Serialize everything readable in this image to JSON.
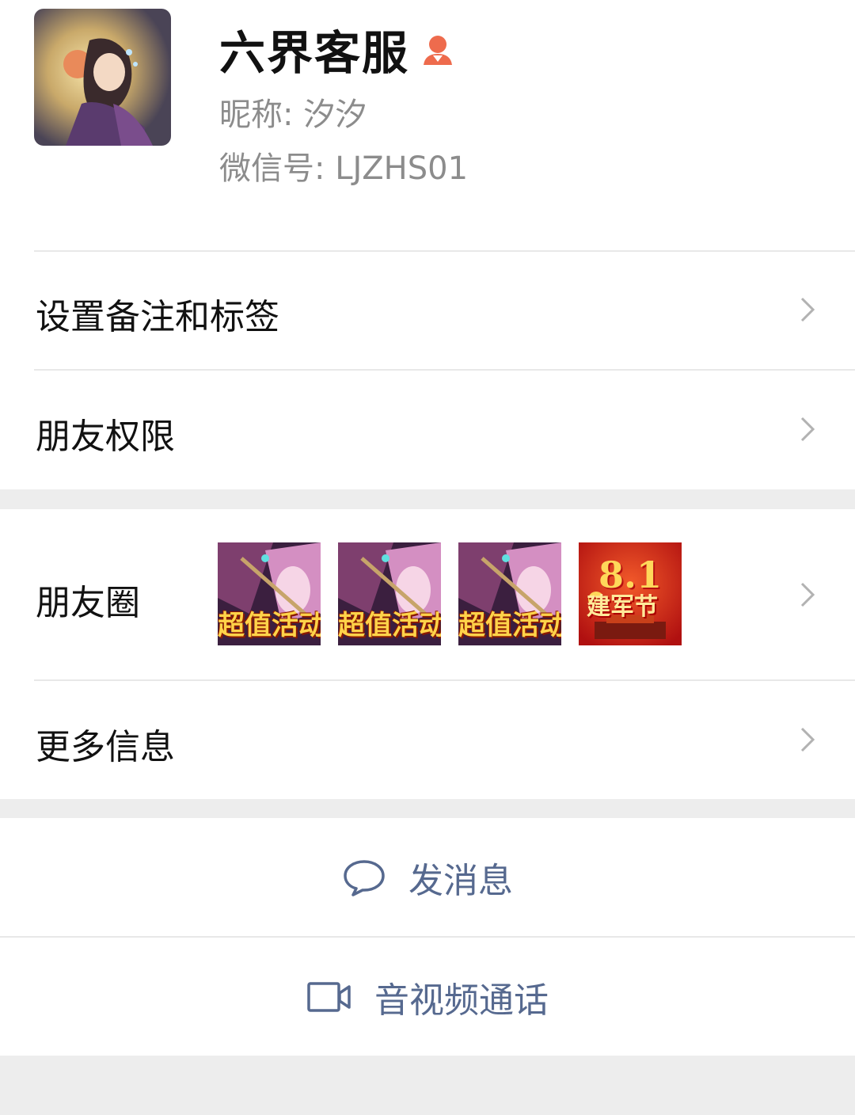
{
  "profile": {
    "name": "六界客服",
    "nickname": "昵称:  汐汐",
    "wechat_id": "微信号:  LJZHS01",
    "gender_icon": "female-person-icon",
    "gender_color": "#ee6b4d"
  },
  "menu": {
    "remark": "设置备注和标签",
    "permissions": "朋友权限",
    "moments": "朋友圈",
    "more": "更多信息"
  },
  "moments_thumbs": [
    {
      "caption": "超值活动"
    },
    {
      "caption": "超值活动"
    },
    {
      "caption": "超值活动"
    },
    {
      "caption_title": "8.1",
      "caption_sub": "建军节"
    }
  ],
  "actions": {
    "message": "发消息",
    "call": "音视频通话",
    "accent": "#56698f"
  }
}
